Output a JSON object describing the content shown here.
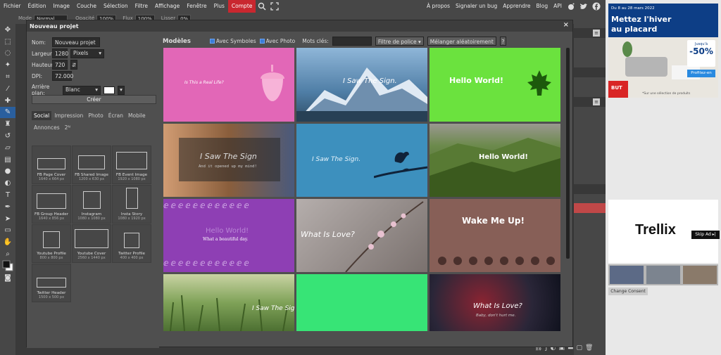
{
  "menu": {
    "left": [
      "Fichier",
      "Édition",
      "Image",
      "Couche",
      "Sélection",
      "Filtre",
      "Affichage",
      "Fenêtre",
      "Plus",
      "Compte"
    ],
    "active": "Compte",
    "right": [
      "À propos",
      "Signaler un bug",
      "Apprendre",
      "Blog",
      "API"
    ]
  },
  "options": {
    "mode_label": "Mode",
    "mode_value": "Normal",
    "opacity_label": "Opacité",
    "opacity_value": "100%",
    "flow_label": "Flux",
    "flow_value": "100%",
    "smooth_label": "Lisser",
    "smooth_value": "0%"
  },
  "modal": {
    "title": "Nouveau projet",
    "close": "×",
    "form": {
      "name_label": "Nom:",
      "name_value": "Nouveau projet",
      "width_label": "Largeur:",
      "width_value": "1280",
      "unit": "Pixels",
      "height_label": "Hauteur:",
      "height_value": "720",
      "dpi_label": "DPI:",
      "dpi_value": "72.000",
      "bg_label": "Arrière plan:",
      "bg_value": "Blanc",
      "create": "Créer"
    },
    "tabs": [
      "Social",
      "Impression",
      "Photo",
      "Écran",
      "Mobile",
      "Annonces",
      "2ᴺ"
    ],
    "active_tab": "Social",
    "presets": [
      {
        "name": "FB Page Cover",
        "size": "1640 x 664 px"
      },
      {
        "name": "FB Shared Image",
        "size": "1200 x 630 px"
      },
      {
        "name": "FB Event Image",
        "size": "1920 x 1080 px"
      },
      {
        "name": "FB Group Header",
        "size": "1640 x 856 px"
      },
      {
        "name": "Instagram",
        "size": "1080 x 1080 px"
      },
      {
        "name": "Insta Story",
        "size": "1080 x 1920 px"
      },
      {
        "name": "Youtube Profile",
        "size": "800 x 800 px"
      },
      {
        "name": "Youtube Cover",
        "size": "2560 x 1440 px"
      },
      {
        "name": "Twitter Profile",
        "size": "400 x 400 px"
      },
      {
        "name": "Twitter Header",
        "size": "1500 x 500 px"
      }
    ],
    "templates_header": {
      "title": "Modèles",
      "symbols": "Avec Symboles",
      "photo": "Avec Photo",
      "keywords_label": "Mots clés:",
      "font_filter": "Filtre de police",
      "shuffle": "Mélanger aléatoirement",
      "help": "?"
    },
    "templates": [
      {
        "title": "Is This a Real Life?",
        "sub": "",
        "bg": "#e267b7"
      },
      {
        "title": "I Saw The Sign.",
        "sub": "",
        "bg": "#5d8fb8"
      },
      {
        "title": "Hello World!",
        "sub": "",
        "bg": "#6be23e"
      },
      {
        "title": "I Saw The Sign",
        "sub": "And it opened up my mind!",
        "bg": "#a2734c"
      },
      {
        "title": "I Saw The Sign.",
        "sub": "",
        "bg": "#3d90be"
      },
      {
        "title": "Hello World!",
        "sub": "",
        "bg": "#5a7a3c"
      },
      {
        "title": "Hello World!",
        "sub": "What a beautiful day.",
        "bg": "#8e3fb4"
      },
      {
        "title": "What Is Love?",
        "sub": "",
        "bg": "#8f8885"
      },
      {
        "title": "Wake Me Up!",
        "sub": "",
        "bg": "#875f57"
      },
      {
        "title": "I Saw The Sign.",
        "sub": "",
        "bg": "#89a863"
      },
      {
        "title": "",
        "sub": "",
        "bg": "#37e476"
      },
      {
        "title": "What Is Love?",
        "sub": "Baby, don't hurt me.",
        "bg": "#29253a"
      }
    ]
  },
  "ad": {
    "date": "Du 8 au 28 mars 2022",
    "headline": "Mettez l'hiver au placard",
    "up_to": "Jusqu'à",
    "discount": "-50%",
    "cta": "Profitez-en",
    "brand": "BUT",
    "fine": "*Sur une sélection de produits",
    "trellix": "Trellix",
    "skip": "Skip Ad ▸|",
    "consent": "Change Consent"
  }
}
